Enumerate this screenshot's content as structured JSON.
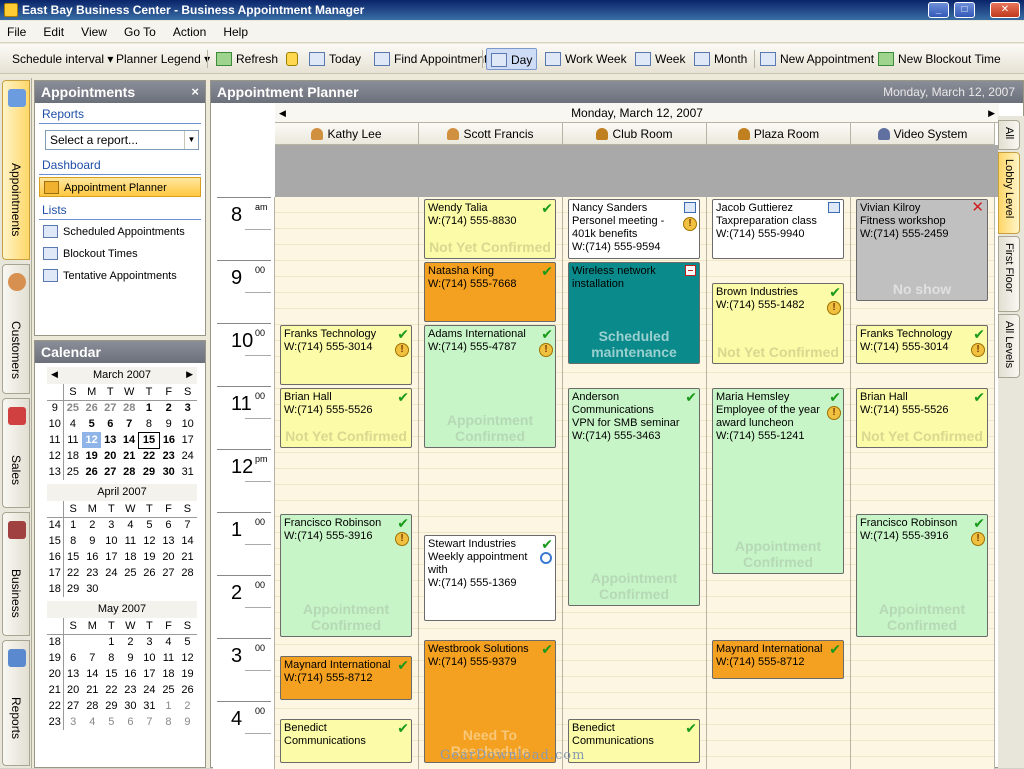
{
  "window": {
    "title": "East Bay Business Center - Business Appointment Manager"
  },
  "menu": [
    "File",
    "Edit",
    "View",
    "Go To",
    "Action",
    "Help"
  ],
  "toolbar": {
    "schedule_interval": "Schedule interval",
    "planner_legend": "Planner Legend",
    "refresh": "Refresh",
    "today": "Today",
    "find_appointment": "Find Appointment",
    "day": "Day",
    "work_week": "Work Week",
    "week": "Week",
    "month": "Month",
    "new_appointment": "New Appointment",
    "new_blockout": "New Blockout Time"
  },
  "left_tabs": [
    "Appointments",
    "Customers",
    "Sales",
    "Business",
    "Reports"
  ],
  "nav": {
    "title": "Appointments",
    "reports_label": "Reports",
    "report_select": "Select a report...",
    "dashboard_label": "Dashboard",
    "dashboard_item": "Appointment Planner",
    "lists_label": "Lists",
    "lists": [
      "Scheduled Appointments",
      "Blockout Times",
      "Tentative Appointments"
    ]
  },
  "calendar": {
    "title": "Calendar",
    "days": [
      "S",
      "M",
      "T",
      "W",
      "T",
      "F",
      "S"
    ],
    "months": [
      {
        "name": "March 2007",
        "weeks": [
          {
            "wk": "9",
            "d": [
              "25",
              "26",
              "27",
              "28",
              "1",
              "2",
              "3"
            ]
          },
          {
            "wk": "10",
            "d": [
              "4",
              "5",
              "6",
              "7",
              "8",
              "9",
              "10"
            ]
          },
          {
            "wk": "11",
            "d": [
              "11",
              "12",
              "13",
              "14",
              "15",
              "16",
              "17"
            ]
          },
          {
            "wk": "12",
            "d": [
              "18",
              "19",
              "20",
              "21",
              "22",
              "23",
              "24"
            ]
          },
          {
            "wk": "13",
            "d": [
              "25",
              "26",
              "27",
              "28",
              "29",
              "30",
              "31"
            ]
          }
        ]
      },
      {
        "name": "April 2007",
        "weeks": [
          {
            "wk": "14",
            "d": [
              "1",
              "2",
              "3",
              "4",
              "5",
              "6",
              "7"
            ]
          },
          {
            "wk": "15",
            "d": [
              "8",
              "9",
              "10",
              "11",
              "12",
              "13",
              "14"
            ]
          },
          {
            "wk": "16",
            "d": [
              "15",
              "16",
              "17",
              "18",
              "19",
              "20",
              "21"
            ]
          },
          {
            "wk": "17",
            "d": [
              "22",
              "23",
              "24",
              "25",
              "26",
              "27",
              "28"
            ]
          },
          {
            "wk": "18",
            "d": [
              "29",
              "30",
              "",
              "",
              "",
              "",
              ""
            ]
          }
        ]
      },
      {
        "name": "May 2007",
        "weeks": [
          {
            "wk": "18",
            "d": [
              "",
              "",
              "1",
              "2",
              "3",
              "4",
              "5"
            ]
          },
          {
            "wk": "19",
            "d": [
              "6",
              "7",
              "8",
              "9",
              "10",
              "11",
              "12"
            ]
          },
          {
            "wk": "20",
            "d": [
              "13",
              "14",
              "15",
              "16",
              "17",
              "18",
              "19"
            ]
          },
          {
            "wk": "21",
            "d": [
              "20",
              "21",
              "22",
              "23",
              "24",
              "25",
              "26"
            ]
          },
          {
            "wk": "22",
            "d": [
              "27",
              "28",
              "29",
              "30",
              "31",
              "1",
              "2"
            ]
          },
          {
            "wk": "23",
            "d": [
              "3",
              "4",
              "5",
              "6",
              "7",
              "8",
              "9"
            ]
          }
        ]
      }
    ]
  },
  "planner": {
    "title": "Appointment Planner",
    "header_date": "Monday, March 12, 2007",
    "day_label": "Monday, March 12, 2007",
    "resources": [
      "Kathy Lee",
      "Scott Francis",
      "Club Room",
      "Plaza Room",
      "Video System"
    ],
    "hours": [
      {
        "h": "8",
        "m": "am"
      },
      {
        "h": "9",
        "m": "00"
      },
      {
        "h": "10",
        "m": "00"
      },
      {
        "h": "11",
        "m": "00"
      },
      {
        "h": "12",
        "m": "pm"
      },
      {
        "h": "1",
        "m": "00"
      },
      {
        "h": "2",
        "m": "00"
      },
      {
        "h": "3",
        "m": "00"
      },
      {
        "h": "4",
        "m": "00"
      }
    ],
    "appointments": [
      {
        "col": 0,
        "start": 2,
        "end": 3,
        "cls": "yel",
        "lines": [
          "Franks Technology",
          "W:(714) 555-3014"
        ],
        "status": "",
        "icons": [
          "check",
          "warn"
        ]
      },
      {
        "col": 0,
        "start": 3,
        "end": 4,
        "cls": "yel",
        "lines": [
          "Brian Hall",
          "W:(714) 555-5526"
        ],
        "status": "Not Yet Confirmed",
        "icons": [
          "check"
        ]
      },
      {
        "col": 0,
        "start": 5,
        "end": 7,
        "cls": "grn",
        "lines": [
          "Francisco Robinson",
          "W:(714) 555-3916"
        ],
        "status": "Appointment Confirmed",
        "icons": [
          "check",
          "warn"
        ]
      },
      {
        "col": 0,
        "start": 7.25,
        "end": 8,
        "cls": "org",
        "lines": [
          "Maynard International",
          "W:(714) 555-8712"
        ],
        "status": "",
        "icons": [
          "check"
        ]
      },
      {
        "col": 0,
        "start": 8.25,
        "end": 9,
        "cls": "yel",
        "lines": [
          "Benedict",
          "Communications"
        ],
        "status": "",
        "icons": [
          "check"
        ]
      },
      {
        "col": 1,
        "start": 0,
        "end": 1,
        "cls": "yel",
        "lines": [
          "Wendy Talia",
          "W:(714) 555-8830"
        ],
        "status": "Not Yet Confirmed",
        "icons": [
          "check"
        ]
      },
      {
        "col": 1,
        "start": 1,
        "end": 2,
        "cls": "org",
        "lines": [
          "Natasha King",
          "W:(714) 555-7668"
        ],
        "status": "",
        "icons": [
          "check"
        ]
      },
      {
        "col": 1,
        "start": 2,
        "end": 4,
        "cls": "grn",
        "lines": [
          "Adams International",
          "W:(714) 555-4787"
        ],
        "status": "Appointment Confirmed",
        "icons": [
          "check",
          "warn"
        ]
      },
      {
        "col": 1,
        "start": 5.33,
        "end": 6.75,
        "cls": "wht",
        "lines": [
          "Stewart Industries",
          "Weekly appointment",
          "with",
          "W:(714) 555-1369"
        ],
        "status": "",
        "icons": [
          "check",
          "recur"
        ]
      },
      {
        "col": 1,
        "start": 7,
        "end": 9,
        "cls": "org",
        "lines": [
          "Westbrook Solutions",
          "W:(714) 555-9379"
        ],
        "status": "Need To Reschedule",
        "icons": [
          "check"
        ]
      },
      {
        "col": 2,
        "start": 0,
        "end": 1,
        "cls": "wht",
        "lines": [
          "Nancy Sanders",
          "Personel meeting -",
          "401k benefits",
          "W:(714) 555-9594"
        ],
        "status": "",
        "icons": [
          "block",
          "warn"
        ]
      },
      {
        "col": 2,
        "start": 1,
        "end": 2.67,
        "cls": "tea",
        "lines": [
          "Wireless network",
          "installation"
        ],
        "status": "Scheduled maintenance",
        "icons": [
          "min"
        ]
      },
      {
        "col": 2,
        "start": 3,
        "end": 6.5,
        "cls": "grn",
        "lines": [
          "Anderson",
          "Communications",
          "VPN for SMB seminar",
          "W:(714) 555-3463"
        ],
        "status": "Appointment Confirmed",
        "icons": [
          "check"
        ]
      },
      {
        "col": 2,
        "start": 8.25,
        "end": 9,
        "cls": "yel",
        "lines": [
          "Benedict",
          "Communications"
        ],
        "status": "",
        "icons": [
          "check"
        ]
      },
      {
        "col": 3,
        "start": 0,
        "end": 1,
        "cls": "wht",
        "lines": [
          "Jacob Guttierez",
          "Taxpreparation class",
          "W:(714) 555-9940"
        ],
        "status": "",
        "icons": [
          "block"
        ]
      },
      {
        "col": 3,
        "start": 1.33,
        "end": 2.67,
        "cls": "yel",
        "lines": [
          "Brown Industries",
          "W:(714) 555-1482"
        ],
        "status": "Not Yet Confirmed",
        "icons": [
          "check",
          "warn"
        ]
      },
      {
        "col": 3,
        "start": 3,
        "end": 6,
        "cls": "grn",
        "lines": [
          "Maria Hemsley",
          "Employee of the year",
          "award luncheon",
          "W:(714) 555-1241"
        ],
        "status": "Appointment Confirmed",
        "icons": [
          "check",
          "warn"
        ]
      },
      {
        "col": 3,
        "start": 7,
        "end": 7.67,
        "cls": "org",
        "lines": [
          "Maynard International",
          "W:(714) 555-8712"
        ],
        "status": "",
        "icons": [
          "check"
        ]
      },
      {
        "col": 4,
        "start": 0,
        "end": 1.67,
        "cls": "gry",
        "lines": [
          "Vivian Kilroy",
          "Fitness workshop",
          "W:(714) 555-2459"
        ],
        "status": "No show",
        "icons": [
          "x"
        ]
      },
      {
        "col": 4,
        "start": 2,
        "end": 2.67,
        "cls": "yel",
        "lines": [
          "Franks Technology",
          "W:(714) 555-3014"
        ],
        "status": "",
        "icons": [
          "check",
          "warn"
        ]
      },
      {
        "col": 4,
        "start": 3,
        "end": 4,
        "cls": "yel",
        "lines": [
          "Brian Hall",
          "W:(714) 555-5526"
        ],
        "status": "Not Yet Confirmed",
        "icons": [
          "check"
        ]
      },
      {
        "col": 4,
        "start": 5,
        "end": 7,
        "cls": "grn",
        "lines": [
          "Francisco Robinson",
          "W:(714) 555-3916"
        ],
        "status": "Appointment Confirmed",
        "icons": [
          "check",
          "warn"
        ]
      }
    ]
  },
  "right_tabs": [
    "All",
    "Lobby Level",
    "First Floor",
    "All Levels"
  ],
  "watermark": "GearDownload.com"
}
